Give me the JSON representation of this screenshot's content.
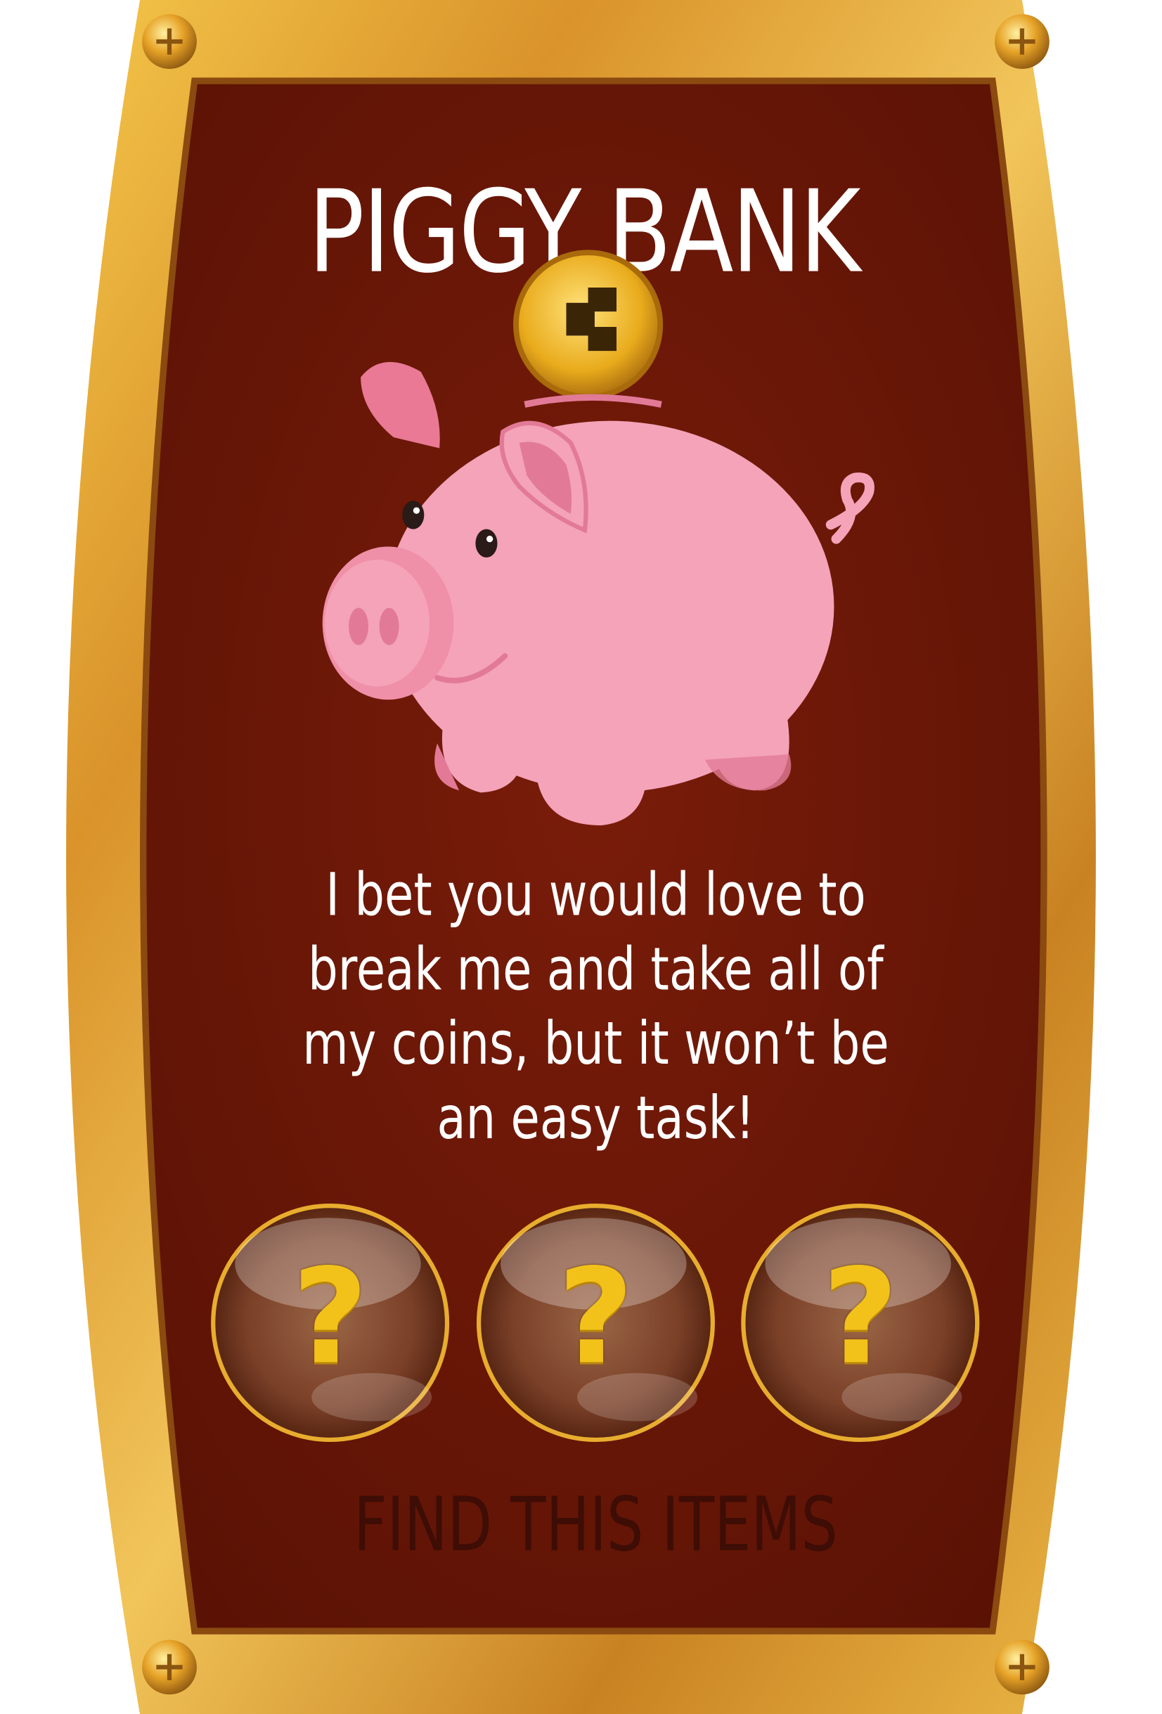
{
  "card": {
    "title": "PIGGY BANK",
    "description": "I bet you would love to break me and take all of my coins, but it won’t be an easy task!",
    "footer": "FIND THIS ITEMS",
    "accent_gold": "#e0a12a",
    "panel_color": "#6a1707",
    "coin_icon": "coin-icon",
    "pig_icon": "piggy-bank-icon"
  },
  "item_slots": [
    {
      "mark": "?"
    },
    {
      "mark": "?"
    },
    {
      "mark": "?"
    }
  ]
}
